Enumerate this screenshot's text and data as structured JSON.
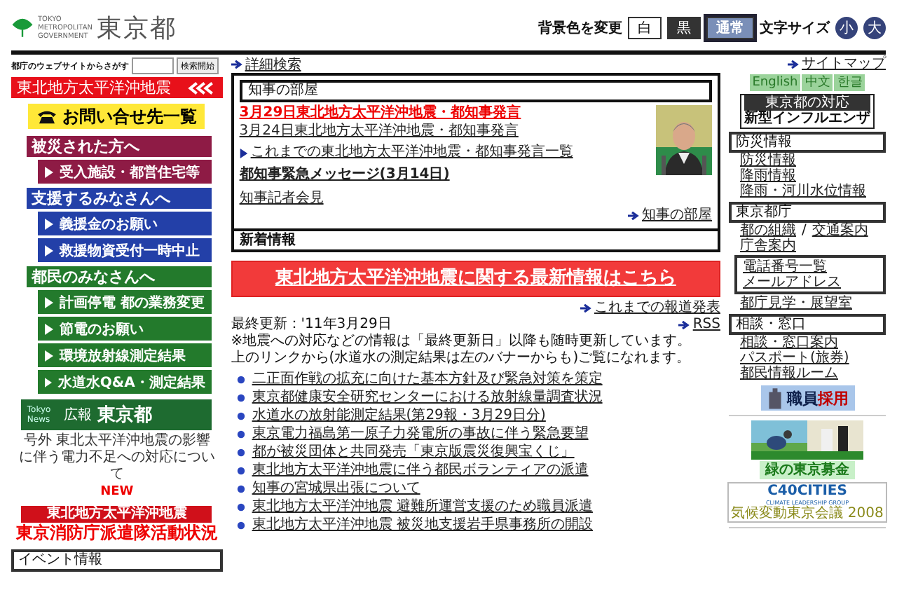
{
  "header": {
    "logo_small": [
      "TOKYO",
      "METROPOLITAN",
      "GOVERNMENT"
    ],
    "logo": "東京都",
    "bg_label": "背景色を変更",
    "bg_options": [
      {
        "label": "白",
        "kind": "white",
        "selected": false
      },
      {
        "label": "黒",
        "kind": "black",
        "selected": false
      },
      {
        "label": "通常",
        "kind": "normal",
        "selected": true
      }
    ],
    "size_label": "文字サイズ",
    "size_buttons": [
      "小",
      "大"
    ]
  },
  "search": {
    "label": "都庁のウェブサイトからさがす",
    "button": "検索開始",
    "advanced_link": "詳細検索",
    "sitemap_link": "サイトマップ"
  },
  "left": {
    "disaster_bar": "東北地方太平洋沖地震",
    "contact_button": "お問い合せ先一覧",
    "sections": [
      {
        "title": "被災された方へ",
        "color": "#8e1b45",
        "buttons": [
          "受入施設・都営住宅等"
        ]
      },
      {
        "title": "支援するみなさんへ",
        "color": "#2340a8",
        "buttons": [
          "義援金のお願い",
          "救援物資受付一時中止"
        ]
      },
      {
        "title": "都民のみなさんへ",
        "color": "#237a2c",
        "buttons": [
          "計画停電 都の業務変更",
          "節電のお願い",
          "環境放射線測定結果",
          "水道水Q&A・測定結果"
        ]
      }
    ],
    "news_banner": {
      "tag": "Tokyo News",
      "sub": "広報",
      "title": "東京都"
    },
    "news_note": "号外 東北太平洋沖地震の影響に伴う電力不足への対応について",
    "new_badge": "NEW",
    "fire_banner": {
      "top": "東北地方太平洋沖地震",
      "main": "東京消防庁派遣隊活動状況"
    },
    "event_header": "イベント情報"
  },
  "governor": {
    "title": "知事の部屋",
    "links": [
      {
        "text": "3月29日東北地方太平洋沖地震・都知事発言",
        "highlight": true
      },
      {
        "text": "3月24日東北地方太平洋沖地震・都知事発言",
        "highlight": false
      }
    ],
    "list_link": "これまでの東北地方太平洋沖地震・都知事発言一覧",
    "message": "都知事緊急メッセージ(3月14日)",
    "press": "知事記者会見",
    "more": "知事の部屋"
  },
  "new_info": {
    "title": "新着情報",
    "banner": "東北地方太平洋沖地震に関する最新情報はこちら",
    "archive": "これまでの報道発表",
    "updated": "最終更新：'11年3月29日",
    "rss": "RSS",
    "notes": [
      "※地震への対応などの情報は「最終更新日」以降も随時更新しています。",
      "上のリンクから(水道水の測定結果は左のバナーからも)ご覧になれます。"
    ],
    "items": [
      "二正面作戦の拡充に向けた基本方針及び緊急対策を策定",
      "東京都健康安全研究センターにおける放射線量調査状況",
      "水道水の放射能測定結果(第29報・3月29日分)",
      "東京電力福島第一原子力発電所の事故に伴う緊急要望",
      "都が被災団体と共同発売「東京版震災復興宝くじ」",
      "東北地方太平洋沖地震に伴う都民ボランティアの派遣",
      "知事の宮城県出張について",
      "東北地方太平洋沖地震 避難所運営支援のため職員派遣",
      "東北地方太平洋沖地震 被災地支援岩手県事務所の開設"
    ]
  },
  "right": {
    "languages": [
      "English",
      "中文",
      "한글"
    ],
    "flu_banner": {
      "top": "東京都の対応",
      "main": "新型インフルエンザ"
    },
    "sections": [
      {
        "title": "防災情報",
        "items": [
          {
            "kind": "link",
            "text": "防災情報"
          },
          {
            "kind": "link",
            "text": "降雨情報"
          },
          {
            "kind": "link",
            "text": "降雨・河川水位情報"
          }
        ]
      },
      {
        "title": "東京都庁",
        "items": [
          {
            "kind": "pair",
            "links": [
              "都の組織",
              "交通案内"
            ],
            "sep": "/"
          },
          {
            "kind": "link",
            "text": "庁舎案内"
          },
          {
            "kind": "box",
            "links": [
              "電話番号一覧",
              "メールアドレス"
            ]
          },
          {
            "kind": "link",
            "text": "都庁見学・展望室"
          }
        ]
      },
      {
        "title": "相談・窓口",
        "items": [
          {
            "kind": "link",
            "text": "相談・窓口案内"
          },
          {
            "kind": "link",
            "text": "パスポート(旅券)"
          },
          {
            "kind": "link",
            "text": "都民情報ルーム"
          }
        ]
      }
    ],
    "recruit_banner": [
      "職員",
      "採用"
    ],
    "photo_banner": {
      "kind": "picture"
    },
    "fund_banner": "緑の東京募金",
    "c40": {
      "title": "C40CITIES",
      "sub": "CLIMATE LEADERSHIP GROUP",
      "jp": "気候変動東京会議",
      "year": "2008"
    }
  }
}
